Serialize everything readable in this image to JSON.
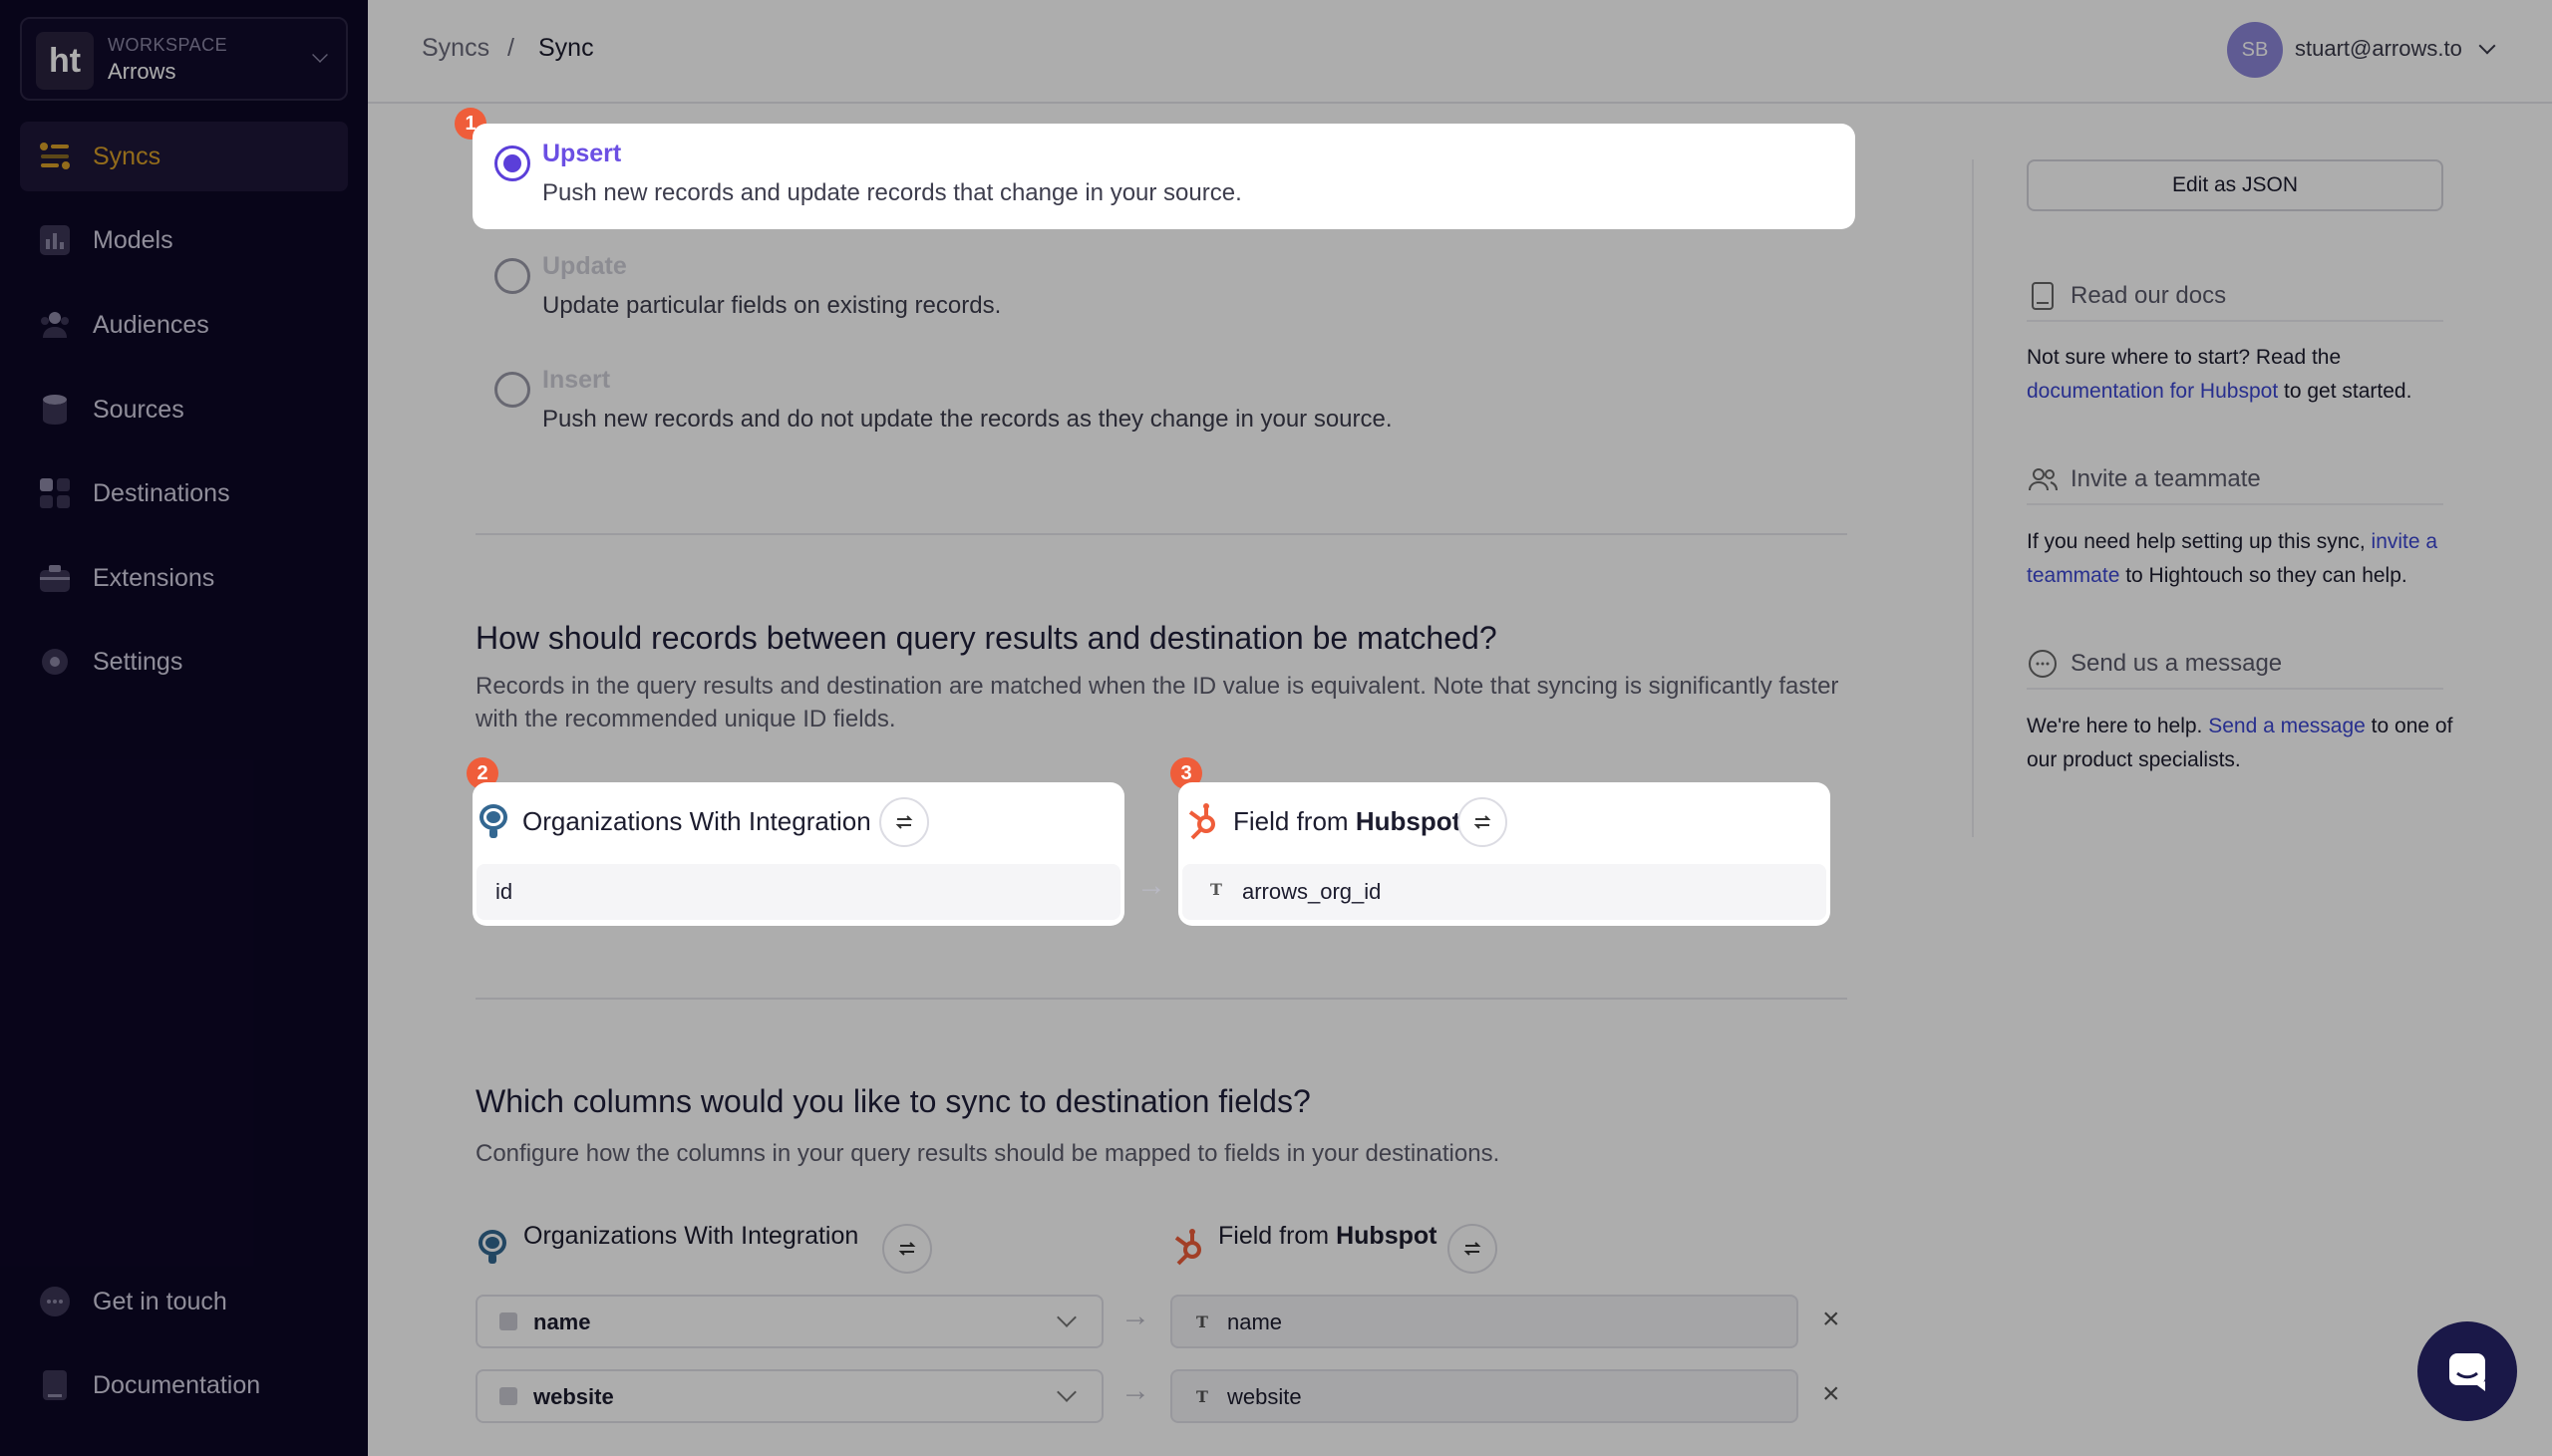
{
  "workspace": {
    "logo": "ht",
    "label": "WORKSPACE",
    "name": "Arrows"
  },
  "sidebar": {
    "items": [
      {
        "label": "Syncs",
        "icon": "syncs-icon",
        "active": true
      },
      {
        "label": "Models",
        "icon": "models-icon"
      },
      {
        "label": "Audiences",
        "icon": "audiences-icon"
      },
      {
        "label": "Sources",
        "icon": "sources-icon"
      },
      {
        "label": "Destinations",
        "icon": "destinations-icon"
      },
      {
        "label": "Extensions",
        "icon": "extensions-icon"
      },
      {
        "label": "Settings",
        "icon": "settings-icon"
      }
    ],
    "footer": [
      {
        "label": "Get in touch",
        "icon": "chat-bubble-icon"
      },
      {
        "label": "Documentation",
        "icon": "book-icon"
      }
    ]
  },
  "breadcrumb": {
    "parent": "Syncs",
    "separator": "/",
    "current": "Sync"
  },
  "user": {
    "initials": "SB",
    "email": "stuart@arrows.to"
  },
  "modes": [
    {
      "title": "Upsert",
      "desc": "Push new records and update records that change in your source.",
      "selected": true,
      "badge": "1"
    },
    {
      "title": "Update",
      "desc": "Update particular fields on existing records."
    },
    {
      "title": "Insert",
      "desc": "Push new records and do not update the records as they change in your source."
    }
  ],
  "matching": {
    "title": "How should records between query results and destination be matched?",
    "desc": "Records in the query results and destination are matched when the ID value is equivalent. Note that syncing is significantly faster with the recommended unique ID fields.",
    "source": {
      "badge": "2",
      "title": "Organizations With Integration",
      "field": "id"
    },
    "destination": {
      "badge": "3",
      "title_prefix": "Field from ",
      "title_bold": "Hubspot",
      "field": "arrows_org_id",
      "type_icon": "T"
    }
  },
  "columns": {
    "title": "Which columns would you like to sync to destination fields?",
    "desc": "Configure how the columns in your query results should be mapped to fields in your destinations.",
    "source_title": "Organizations With Integration",
    "dest_title_prefix": "Field from ",
    "dest_title_bold": "Hubspot",
    "rows": [
      {
        "source": "name",
        "dest": "name",
        "type_icon": "T"
      },
      {
        "source": "website",
        "dest": "website",
        "type_icon": "T"
      }
    ]
  },
  "right_panel": {
    "edit_json": "Edit as JSON",
    "docs": {
      "title": "Read our docs",
      "text_before": "Not sure where to start? Read the ",
      "link": "documentation for Hubspot",
      "text_after": " to get started."
    },
    "invite": {
      "title": "Invite a teammate",
      "text_before": "If you need help setting up this sync, ",
      "link": "invite a teammate",
      "text_after": " to Hightouch so they can help."
    },
    "message": {
      "title": "Send us a message",
      "text_before": "We're here to help. ",
      "link": "Send a message",
      "text_after": " to one of our product specialists."
    }
  },
  "colors": {
    "accent": "#6b4fe3",
    "badge": "#ef5d3a",
    "sidebar_bg": "#0d0826",
    "active_nav": "#d9a028"
  }
}
